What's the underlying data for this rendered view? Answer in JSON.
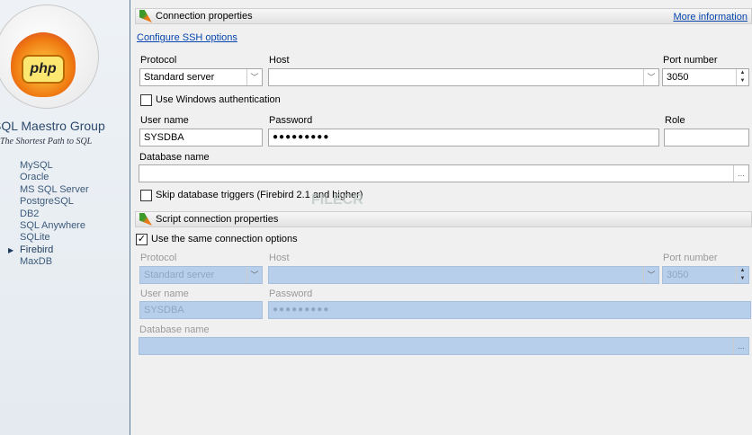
{
  "sidebar": {
    "brand": "SQL Maestro Group",
    "slogan": "The Shortest Path to SQL",
    "logo_text": "php",
    "items": [
      "MySQL",
      "Oracle",
      "MS SQL Server",
      "PostgreSQL",
      "DB2",
      "SQL Anywhere",
      "SQLite",
      "Firebird",
      "MaxDB"
    ],
    "active": "Firebird"
  },
  "connection": {
    "title": "Connection properties",
    "more_info": "More information",
    "ssh_link": "Configure SSH options",
    "protocol_label": "Protocol",
    "protocol_value": "Standard server",
    "host_label": "Host",
    "host_value": "",
    "port_label": "Port number",
    "port_value": "3050",
    "win_auth": "Use Windows authentication",
    "user_label": "User name",
    "user_value": "SYSDBA",
    "password_label": "Password",
    "password_value": "●●●●●●●●●",
    "role_label": "Role",
    "role_value": "",
    "db_label": "Database name",
    "db_value": "",
    "browse": "...",
    "skip_triggers": "Skip database triggers (Firebird 2.1 and higher)"
  },
  "script": {
    "title": "Script connection properties",
    "same_options": "Use the same connection options",
    "same_checked": "✓",
    "protocol_label": "Protocol",
    "protocol_value": "Standard server",
    "host_label": "Host",
    "port_label": "Port number",
    "port_value": "3050",
    "user_label": "User name",
    "user_value": "SYSDBA",
    "password_label": "Password",
    "password_value": "●●●●●●●●●",
    "db_label": "Database name",
    "browse": "..."
  },
  "watermark": "FILECR"
}
